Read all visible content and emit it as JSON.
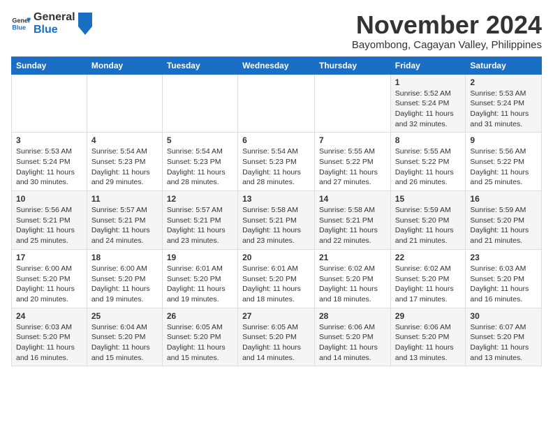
{
  "header": {
    "logo": {
      "text_general": "General",
      "text_blue": "Blue"
    },
    "title": "November 2024",
    "location": "Bayombong, Cagayan Valley, Philippines"
  },
  "calendar": {
    "days_of_week": [
      "Sunday",
      "Monday",
      "Tuesday",
      "Wednesday",
      "Thursday",
      "Friday",
      "Saturday"
    ],
    "weeks": [
      [
        {
          "day": "",
          "info": ""
        },
        {
          "day": "",
          "info": ""
        },
        {
          "day": "",
          "info": ""
        },
        {
          "day": "",
          "info": ""
        },
        {
          "day": "",
          "info": ""
        },
        {
          "day": "1",
          "info": "Sunrise: 5:52 AM\nSunset: 5:24 PM\nDaylight: 11 hours\nand 32 minutes."
        },
        {
          "day": "2",
          "info": "Sunrise: 5:53 AM\nSunset: 5:24 PM\nDaylight: 11 hours\nand 31 minutes."
        }
      ],
      [
        {
          "day": "3",
          "info": "Sunrise: 5:53 AM\nSunset: 5:24 PM\nDaylight: 11 hours\nand 30 minutes."
        },
        {
          "day": "4",
          "info": "Sunrise: 5:54 AM\nSunset: 5:23 PM\nDaylight: 11 hours\nand 29 minutes."
        },
        {
          "day": "5",
          "info": "Sunrise: 5:54 AM\nSunset: 5:23 PM\nDaylight: 11 hours\nand 28 minutes."
        },
        {
          "day": "6",
          "info": "Sunrise: 5:54 AM\nSunset: 5:23 PM\nDaylight: 11 hours\nand 28 minutes."
        },
        {
          "day": "7",
          "info": "Sunrise: 5:55 AM\nSunset: 5:22 PM\nDaylight: 11 hours\nand 27 minutes."
        },
        {
          "day": "8",
          "info": "Sunrise: 5:55 AM\nSunset: 5:22 PM\nDaylight: 11 hours\nand 26 minutes."
        },
        {
          "day": "9",
          "info": "Sunrise: 5:56 AM\nSunset: 5:22 PM\nDaylight: 11 hours\nand 25 minutes."
        }
      ],
      [
        {
          "day": "10",
          "info": "Sunrise: 5:56 AM\nSunset: 5:21 PM\nDaylight: 11 hours\nand 25 minutes."
        },
        {
          "day": "11",
          "info": "Sunrise: 5:57 AM\nSunset: 5:21 PM\nDaylight: 11 hours\nand 24 minutes."
        },
        {
          "day": "12",
          "info": "Sunrise: 5:57 AM\nSunset: 5:21 PM\nDaylight: 11 hours\nand 23 minutes."
        },
        {
          "day": "13",
          "info": "Sunrise: 5:58 AM\nSunset: 5:21 PM\nDaylight: 11 hours\nand 23 minutes."
        },
        {
          "day": "14",
          "info": "Sunrise: 5:58 AM\nSunset: 5:21 PM\nDaylight: 11 hours\nand 22 minutes."
        },
        {
          "day": "15",
          "info": "Sunrise: 5:59 AM\nSunset: 5:20 PM\nDaylight: 11 hours\nand 21 minutes."
        },
        {
          "day": "16",
          "info": "Sunrise: 5:59 AM\nSunset: 5:20 PM\nDaylight: 11 hours\nand 21 minutes."
        }
      ],
      [
        {
          "day": "17",
          "info": "Sunrise: 6:00 AM\nSunset: 5:20 PM\nDaylight: 11 hours\nand 20 minutes."
        },
        {
          "day": "18",
          "info": "Sunrise: 6:00 AM\nSunset: 5:20 PM\nDaylight: 11 hours\nand 19 minutes."
        },
        {
          "day": "19",
          "info": "Sunrise: 6:01 AM\nSunset: 5:20 PM\nDaylight: 11 hours\nand 19 minutes."
        },
        {
          "day": "20",
          "info": "Sunrise: 6:01 AM\nSunset: 5:20 PM\nDaylight: 11 hours\nand 18 minutes."
        },
        {
          "day": "21",
          "info": "Sunrise: 6:02 AM\nSunset: 5:20 PM\nDaylight: 11 hours\nand 18 minutes."
        },
        {
          "day": "22",
          "info": "Sunrise: 6:02 AM\nSunset: 5:20 PM\nDaylight: 11 hours\nand 17 minutes."
        },
        {
          "day": "23",
          "info": "Sunrise: 6:03 AM\nSunset: 5:20 PM\nDaylight: 11 hours\nand 16 minutes."
        }
      ],
      [
        {
          "day": "24",
          "info": "Sunrise: 6:03 AM\nSunset: 5:20 PM\nDaylight: 11 hours\nand 16 minutes."
        },
        {
          "day": "25",
          "info": "Sunrise: 6:04 AM\nSunset: 5:20 PM\nDaylight: 11 hours\nand 15 minutes."
        },
        {
          "day": "26",
          "info": "Sunrise: 6:05 AM\nSunset: 5:20 PM\nDaylight: 11 hours\nand 15 minutes."
        },
        {
          "day": "27",
          "info": "Sunrise: 6:05 AM\nSunset: 5:20 PM\nDaylight: 11 hours\nand 14 minutes."
        },
        {
          "day": "28",
          "info": "Sunrise: 6:06 AM\nSunset: 5:20 PM\nDaylight: 11 hours\nand 14 minutes."
        },
        {
          "day": "29",
          "info": "Sunrise: 6:06 AM\nSunset: 5:20 PM\nDaylight: 11 hours\nand 13 minutes."
        },
        {
          "day": "30",
          "info": "Sunrise: 6:07 AM\nSunset: 5:20 PM\nDaylight: 11 hours\nand 13 minutes."
        }
      ]
    ]
  }
}
